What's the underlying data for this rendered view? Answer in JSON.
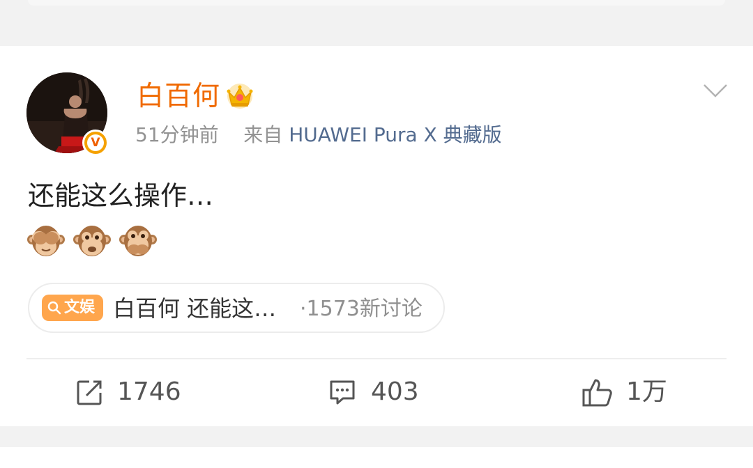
{
  "post": {
    "author": {
      "name": "白百何",
      "badge_icon": "crown-icon",
      "verified_letter": "V",
      "verified_color": "#f5a100"
    },
    "time": "51分钟前",
    "source_prefix": "来自",
    "source_device": "HUAWEI Pura X 典藏版",
    "text": "还能这么操作…",
    "emojis": [
      "see-no-evil-monkey-icon",
      "monkey-face-icon",
      "speak-no-evil-monkey-icon"
    ]
  },
  "topic": {
    "tag_label": "文娱",
    "title": "白百何 还能这…",
    "count": "·1573新讨论"
  },
  "actions": {
    "repost_count": "1746",
    "comment_count": "403",
    "like_count": "1万"
  },
  "colors": {
    "username": "#f06a00",
    "source_device": "#536b8f",
    "tag_bg": "#ffa64d"
  }
}
